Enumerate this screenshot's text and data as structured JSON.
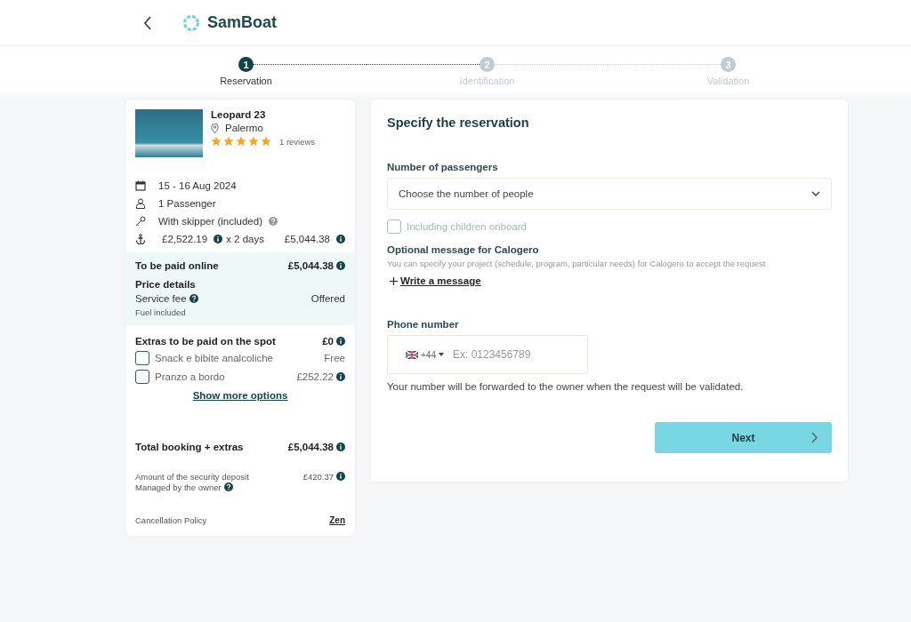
{
  "header": {
    "brand": "SamBoat"
  },
  "steps": [
    {
      "number": "1",
      "label": "Reservation",
      "selected": true
    },
    {
      "number": "2",
      "label": "Identification",
      "selected": false
    },
    {
      "number": "3",
      "label": "Validation",
      "selected": false
    }
  ],
  "summary": {
    "boat": {
      "name": "Leopard 23",
      "location": "Palermo",
      "stars": 5,
      "reviews": "1 reviews"
    },
    "date": "15 - 16 Aug 2024",
    "passengers": "1 Passenger",
    "skipper": "With skipper (included)",
    "price": {
      "rate": "£2,522.19",
      "duration": "x 2 days",
      "total": "£5,044.38"
    },
    "online": {
      "label": "To be paid online",
      "amount": "£5,044.38",
      "details_title": "Price details",
      "fee_label": "Service fee",
      "fee_value": "Offered",
      "fuel": "Fuel included"
    },
    "extras": {
      "label": "Extras to be paid on the spot",
      "amount": "£0",
      "items": [
        {
          "name": "Snack e bibite analcoliche",
          "price": "Free",
          "checked": false,
          "info": false
        },
        {
          "name": "Pranzo a bordo",
          "price": "£252.22",
          "checked": false,
          "info": true
        }
      ],
      "more": "Show more options"
    },
    "total": {
      "label": "Total booking + extras",
      "amount": "£5,044.38"
    },
    "deposit": {
      "label": "Amount of the security deposit",
      "amount": "£420.37",
      "managed": "Managed by the owner"
    },
    "cancellation": {
      "label": "Cancellation Policy",
      "value": "Zen"
    }
  },
  "form": {
    "title": "Specify the reservation",
    "passengers_label": "Number of passengers",
    "passengers_placeholder": "Choose the number of people",
    "children": {
      "label": "Including children onboard",
      "checked": false,
      "disabled": true
    },
    "message_label": "Optional message for Calogero",
    "message_hint": "You can specify your project (schedule, program, particular needs) for Calogero to accept the request",
    "message_link": "Write a message",
    "phone_label": "Phone number",
    "country_code": "+44",
    "phone_placeholder": "Ex: 0123456789",
    "phone_note": "Your number will be forwarded to the owner when the request will be validated.",
    "next": "Next"
  }
}
